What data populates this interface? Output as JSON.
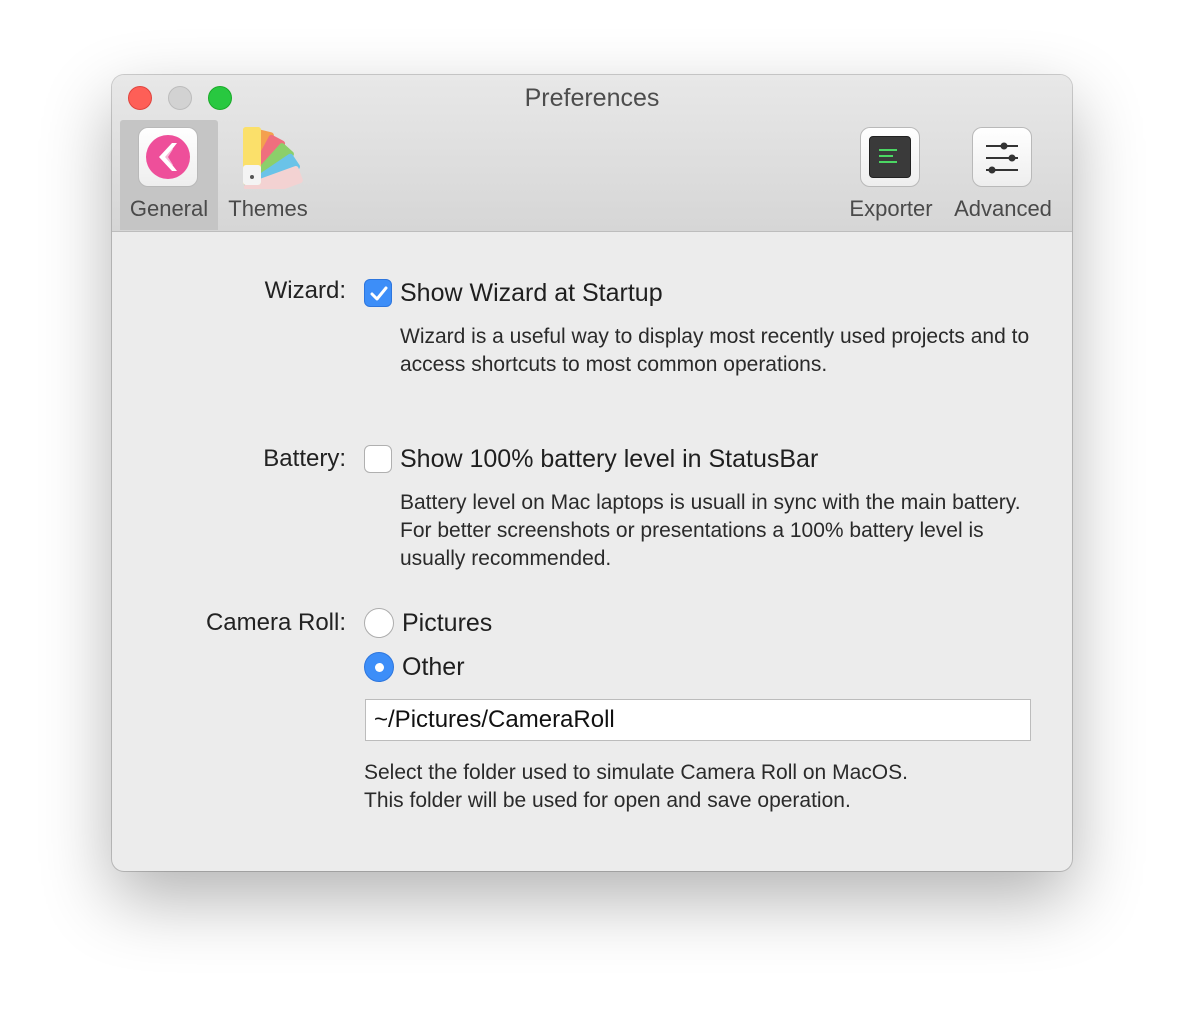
{
  "window": {
    "title": "Preferences"
  },
  "toolbar": {
    "tabs": [
      {
        "label": "General",
        "icon": "general-app-icon",
        "selected": true
      },
      {
        "label": "Themes",
        "icon": "color-swatch-fan-icon",
        "selected": false
      },
      {
        "label": "Exporter",
        "icon": "terminal-icon",
        "selected": false
      },
      {
        "label": "Advanced",
        "icon": "sliders-icon",
        "selected": false
      }
    ]
  },
  "wizard": {
    "label": "Wizard:",
    "checkbox_text": "Show Wizard at Startup",
    "checked": true,
    "help": "Wizard is a useful way to display most recently used projects and to access shortcuts to most common operations."
  },
  "battery": {
    "label": "Battery:",
    "checkbox_text": "Show 100% battery level in StatusBar",
    "checked": false,
    "help": "Battery level on Mac laptops is usuall in sync with the main battery. For better screenshots or presentations a 100% battery level is usually recommended."
  },
  "camera_roll": {
    "label": "Camera Roll:",
    "options": [
      {
        "label": "Pictures",
        "selected": false
      },
      {
        "label": "Other",
        "selected": true
      }
    ],
    "path_value": "~/Pictures/CameraRoll",
    "help_line1": "Select the folder used to simulate Camera Roll on MacOS.",
    "help_line2": "This folder will be used for open and save operation."
  },
  "colors": {
    "accent": "#3d8ef8",
    "close": "#fe5f57",
    "zoom": "#28c840",
    "window_bg": "#ececec"
  }
}
